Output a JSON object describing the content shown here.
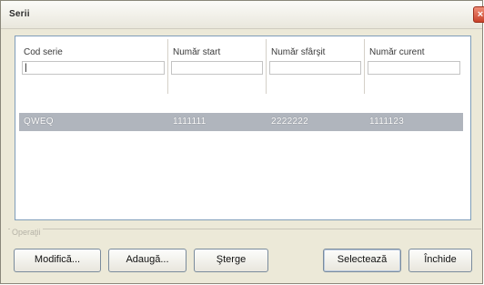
{
  "window": {
    "title": "Serii",
    "close_glyph": "×"
  },
  "grid": {
    "columns": [
      {
        "label": "Cod serie",
        "filter_value": "|"
      },
      {
        "label": "Număr start",
        "filter_value": ""
      },
      {
        "label": "Număr sfârşit",
        "filter_value": ""
      },
      {
        "label": "Număr curent",
        "filter_value": ""
      }
    ],
    "rows": [
      {
        "cells": [
          "QWEQ",
          "1111111",
          "2222222",
          "1111123"
        ]
      }
    ],
    "selected_row_color": "#b0b5bd"
  },
  "group": {
    "legend": "Operaţii"
  },
  "buttons": {
    "modify": "Modifică...",
    "add": "Adaugă...",
    "delete": "Şterge",
    "select": "Selectează",
    "close": "Închide"
  }
}
